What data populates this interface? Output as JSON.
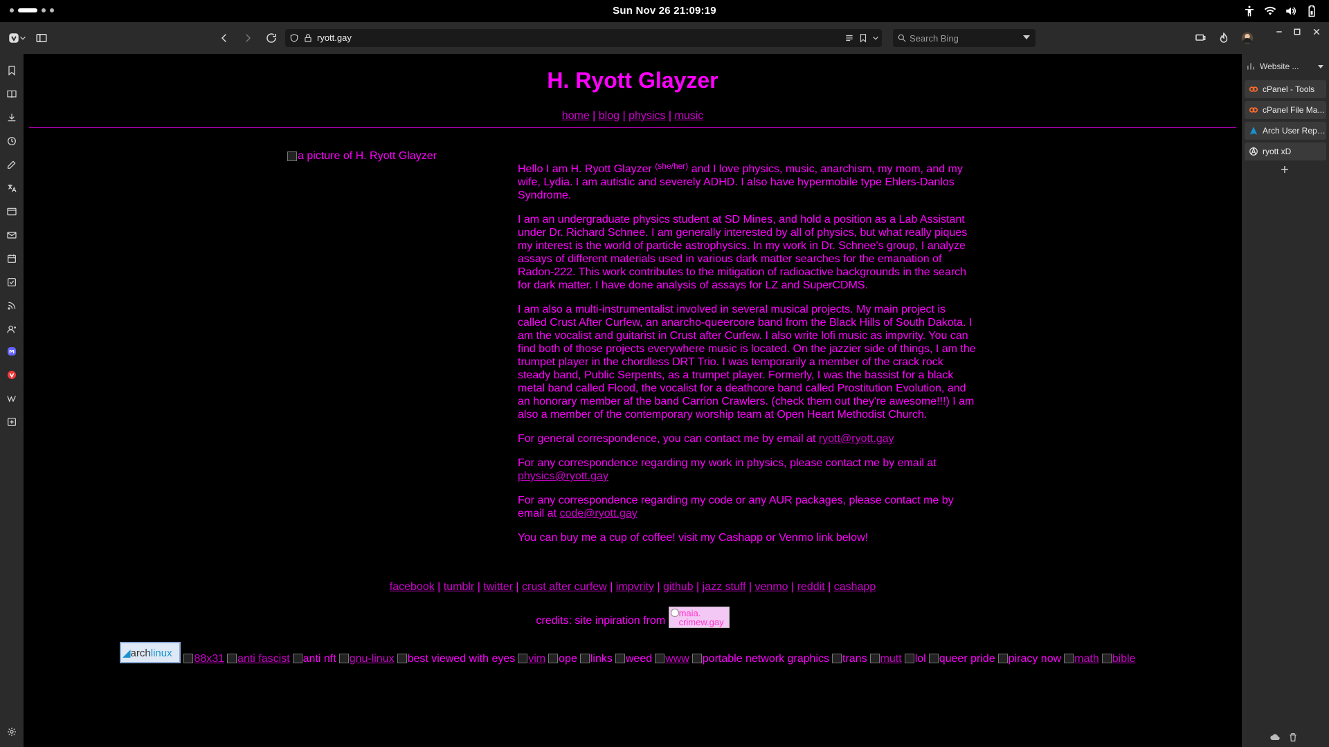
{
  "topbar": {
    "clock": "Sun Nov 26  21:09:19"
  },
  "browser": {
    "url": "ryott.gay",
    "search_placeholder": "Search Bing"
  },
  "right_panel": {
    "header": "Website ...",
    "items": [
      {
        "label": "cPanel - Tools",
        "icon": "cpanel-icon"
      },
      {
        "label": "cPanel File Ma...",
        "icon": "cpanel-icon"
      },
      {
        "label": "Arch User Repo...",
        "icon": "arch-icon"
      },
      {
        "label": "ryott xD",
        "icon": "anarchy-icon"
      }
    ]
  },
  "page": {
    "title": "H. Ryott Glayzer",
    "nav": [
      "home",
      "blog",
      "physics",
      "music"
    ],
    "portrait_alt": "a picture of H. Ryott Glayzer",
    "bio": {
      "p1_a": "Hello I am H. Ryott Glayzer ",
      "p1_pronouns": "(she/her)",
      "p1_b": " and I love physics, music, anarchism, my mom, and my wife, Lydia. I am autistic and severely ADHD. I also have hypermobile type Ehlers-Danlos Syndrome.",
      "p2": "I am an undergraduate physics student at SD Mines, and hold a position as a Lab Assistant under Dr. Richard Schnee. I am generally interested by all of physics, but what really piques my interest is the world of particle astrophysics. In my work in Dr. Schnee's group, I analyze assays of different materials used in various dark matter searches for the emanation of Radon-222. This work contributes to the mitigation of radioactive backgrounds in the search for dark matter. I have done analysis of assays for LZ and SuperCDMS.",
      "p3": "I am also a multi-instrumentalist involved in several musical projects. My main project is called Crust After Curfew, an anarcho-queercore band from the Black Hills of South Dakota. I am the vocalist and guitarist in Crust after Curfew. I also write lofi music as impvrity. You can find both of those projects everywhere music is located. On the jazzier side of things, I am the trumpet player in the chordless DRT Trio. I was temporarily a member of the crack rock steady band, Public Serpents, as a trumpet player. Formerly, I was the bassist for a black metal band called Flood, the vocalist for a deathcore band called Prostitution Evolution, and an honorary member af the band Carrion Crawlers. (check them out they're awesome!!!) I am also a member of the contemporary worship team at Open Heart Methodist Church.",
      "p4": "For general correspondence, you can contact me by email at ",
      "p4_email": "ryott@ryott.gay",
      "p5": "For any correspondence regarding my work in physics, please contact me by email at ",
      "p5_email": "physics@ryott.gay",
      "p6": "For any correspondence regarding my code or any AUR packages, please contact me by email at ",
      "p6_email": "code@ryott.gay",
      "p7": "You can buy me a cup of coffee! visit my Cashapp or Venmo link below!"
    },
    "socials": [
      "facebook",
      "tumblr",
      "twitter",
      "crust after curfew",
      "impvrity",
      "github",
      "jazz stuff",
      "venmo",
      "reddit",
      "cashapp"
    ],
    "credits": {
      "text": "credits: site inpiration from ",
      "button_text": "maia.\ncrimew.gay"
    },
    "arch_button": {
      "arch": "arch",
      "linux": "linux"
    },
    "badges": [
      {
        "text": "88x31",
        "link": true
      },
      {
        "text": "anti fascist",
        "link": true
      },
      {
        "text": "anti nft",
        "link": false
      },
      {
        "text": "gnu-linux",
        "link": true
      },
      {
        "text": "best viewed with eyes",
        "link": false
      },
      {
        "text": "vim",
        "link": true
      },
      {
        "text": "ope",
        "link": false
      },
      {
        "text": "links",
        "link": false
      },
      {
        "text": "weed",
        "link": false
      },
      {
        "text": "www",
        "link": true
      },
      {
        "text": "portable network graphics",
        "link": false
      },
      {
        "text": "trans",
        "link": false
      },
      {
        "text": "mutt",
        "link": true
      },
      {
        "text": "lol",
        "link": false
      },
      {
        "text": "queer pride",
        "link": false
      },
      {
        "text": "piracy now",
        "link": false
      },
      {
        "text": "math",
        "link": true
      },
      {
        "text": "bible",
        "link": true
      }
    ]
  }
}
